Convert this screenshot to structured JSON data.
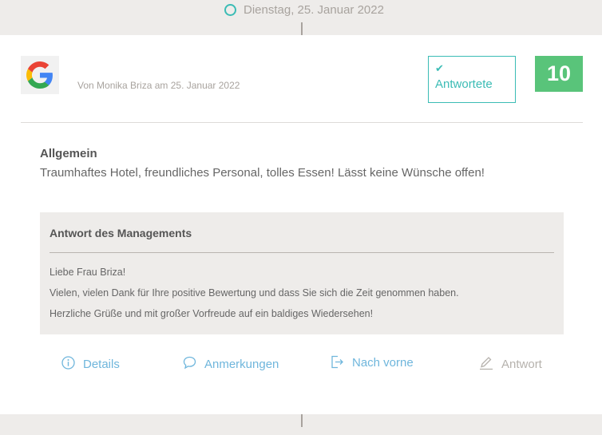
{
  "timeline": {
    "date": "Dienstag, 25. Januar 2022"
  },
  "review": {
    "source_icon": "google-logo",
    "author_line": "Von Monika Briza am 25. Januar 2022",
    "status": {
      "label": "Antwortete",
      "icon": "check-icon",
      "color": "#3bbcb5"
    },
    "score": "10",
    "score_color": "#59c47a",
    "category": "Allgemein",
    "text": "Traumhaftes Hotel, freundliches Personal, tolles Essen! Lässt keine Wünsche offen!"
  },
  "response": {
    "title": "Antwort des Managements",
    "lines": [
      "Liebe Frau Briza!",
      "Vielen, vielen Dank für Ihre positive Bewertung und dass Sie sich die Zeit genommen haben.",
      "Herzliche Grüße und mit großer Vorfreude auf ein baldiges Wiedersehen!"
    ]
  },
  "actions": {
    "details": {
      "label": "Details",
      "icon": "info-icon"
    },
    "notes": {
      "label": "Anmerkungen",
      "icon": "comment-icon"
    },
    "forward": {
      "label": "Nach vorne",
      "icon": "sign-out-icon"
    },
    "reply": {
      "label": "Antwort",
      "icon": "pencil-icon",
      "disabled": true
    }
  }
}
